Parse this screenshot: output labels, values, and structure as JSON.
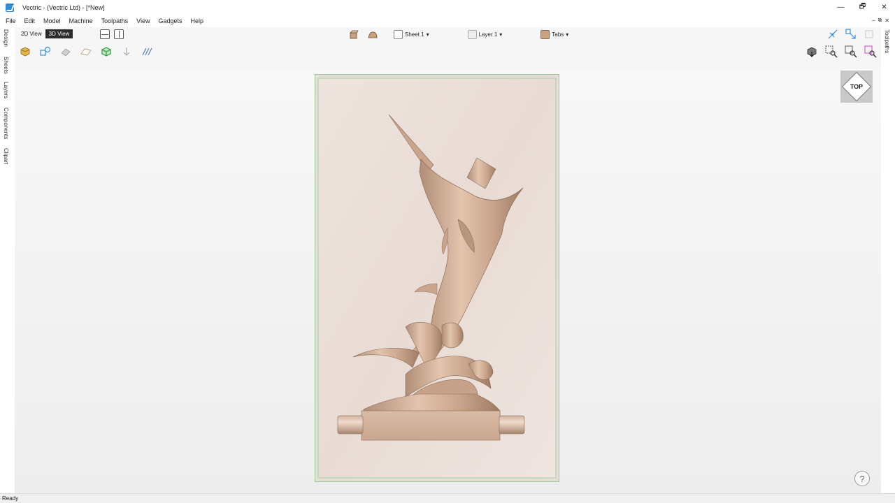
{
  "window": {
    "title": "Vectric - (Vectric Ltd) - [*New]",
    "controls": {
      "minimize": "—",
      "restore": "🗗",
      "close": "✕"
    },
    "mdi_controls": {
      "minimize": "–",
      "restore": "⧉",
      "close": "✕"
    }
  },
  "menu": [
    "File",
    "Edit",
    "Model",
    "Machine",
    "Toolpaths",
    "View",
    "Gadgets",
    "Help"
  ],
  "left_tabs": [
    "Design",
    "Sheets",
    "Layers",
    "Components",
    "Clipart"
  ],
  "right_tabs": [
    "Toolpaths"
  ],
  "toolbar": {
    "view_2d": "2D View",
    "view_3d": "3D View",
    "sheet_label": "Sheet 1",
    "layer_label": "Layer 1",
    "tabs_label": "Tabs",
    "dropdown_arrow": "▾"
  },
  "view_cube": {
    "label": "TOP"
  },
  "help": {
    "label": "?"
  },
  "status": {
    "text": "Ready"
  },
  "colors": {
    "accent_green": "#2e9a3c",
    "accent_blue": "#3b8fd9",
    "wood": "#d8b59c",
    "active_view_bg": "#2b2b2b"
  },
  "icons": [
    "app-icon",
    "draw-mode-icon",
    "sculpt-icon",
    "shade-icon",
    "material-icon",
    "wireframe-icon",
    "toolpath-icon",
    "align-icon",
    "texture-icon",
    "snap-icon",
    "vector-icon",
    "box-icon",
    "zoom-icon",
    "zoom-window-icon",
    "zoom-fit-icon"
  ]
}
